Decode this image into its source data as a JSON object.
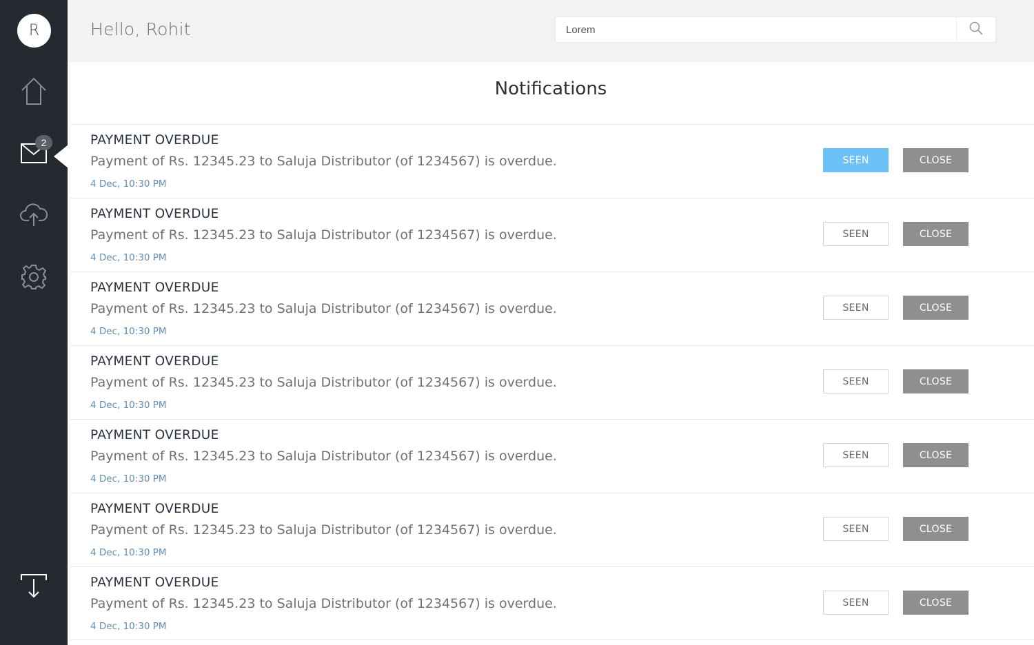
{
  "user": {
    "initial": "R",
    "greeting": "Hello, Rohit"
  },
  "sidebar": {
    "items": [
      {
        "name": "home",
        "icon": "home-icon"
      },
      {
        "name": "messages",
        "icon": "mail-icon",
        "badge": "2",
        "active": true
      },
      {
        "name": "upload",
        "icon": "cloud-upload-icon"
      },
      {
        "name": "settings",
        "icon": "gear-icon"
      }
    ],
    "bottom": {
      "name": "download",
      "icon": "download-tray-icon"
    }
  },
  "search": {
    "value": "Lorem",
    "placeholder": "",
    "icon": "search-icon"
  },
  "page": {
    "title": "Notifications"
  },
  "notifications": [
    {
      "title": "PAYMENT OVERDUE",
      "message": "Payment of Rs. 12345.23 to Saluja Distributor (of 1234567) is overdue.",
      "time": "4 Dec, 10:30 PM",
      "seen_label": "SEEN",
      "close_label": "CLOSE",
      "seen": true
    },
    {
      "title": "PAYMENT OVERDUE",
      "message": "Payment of Rs. 12345.23 to Saluja Distributor (of 1234567) is overdue.",
      "time": "4 Dec, 10:30 PM",
      "seen_label": "SEEN",
      "close_label": "CLOSE",
      "seen": false
    },
    {
      "title": "PAYMENT OVERDUE",
      "message": "Payment of Rs. 12345.23 to Saluja Distributor (of 1234567) is overdue.",
      "time": "4 Dec, 10:30 PM",
      "seen_label": "SEEN",
      "close_label": "CLOSE",
      "seen": false
    },
    {
      "title": "PAYMENT OVERDUE",
      "message": "Payment of Rs. 12345.23 to Saluja Distributor (of 1234567) is overdue.",
      "time": "4 Dec, 10:30 PM",
      "seen_label": "SEEN",
      "close_label": "CLOSE",
      "seen": false
    },
    {
      "title": "PAYMENT OVERDUE",
      "message": "Payment of Rs. 12345.23 to Saluja Distributor (of 1234567) is overdue.",
      "time": "4 Dec, 10:30 PM",
      "seen_label": "SEEN",
      "close_label": "CLOSE",
      "seen": false
    },
    {
      "title": "PAYMENT OVERDUE",
      "message": "Payment of Rs. 12345.23 to Saluja Distributor (of 1234567) is overdue.",
      "time": "4 Dec, 10:30 PM",
      "seen_label": "SEEN",
      "close_label": "CLOSE",
      "seen": false
    },
    {
      "title": "PAYMENT OVERDUE",
      "message": "Payment of Rs. 12345.23 to Saluja Distributor (of 1234567) is overdue.",
      "time": "4 Dec, 10:30 PM",
      "seen_label": "SEEN",
      "close_label": "CLOSE",
      "seen": false
    }
  ],
  "colors": {
    "sidebar_bg": "#252a30",
    "seen_active": "#6cc2f8",
    "close_button": "#8f8f8f",
    "timestamp": "#5f8db5"
  }
}
